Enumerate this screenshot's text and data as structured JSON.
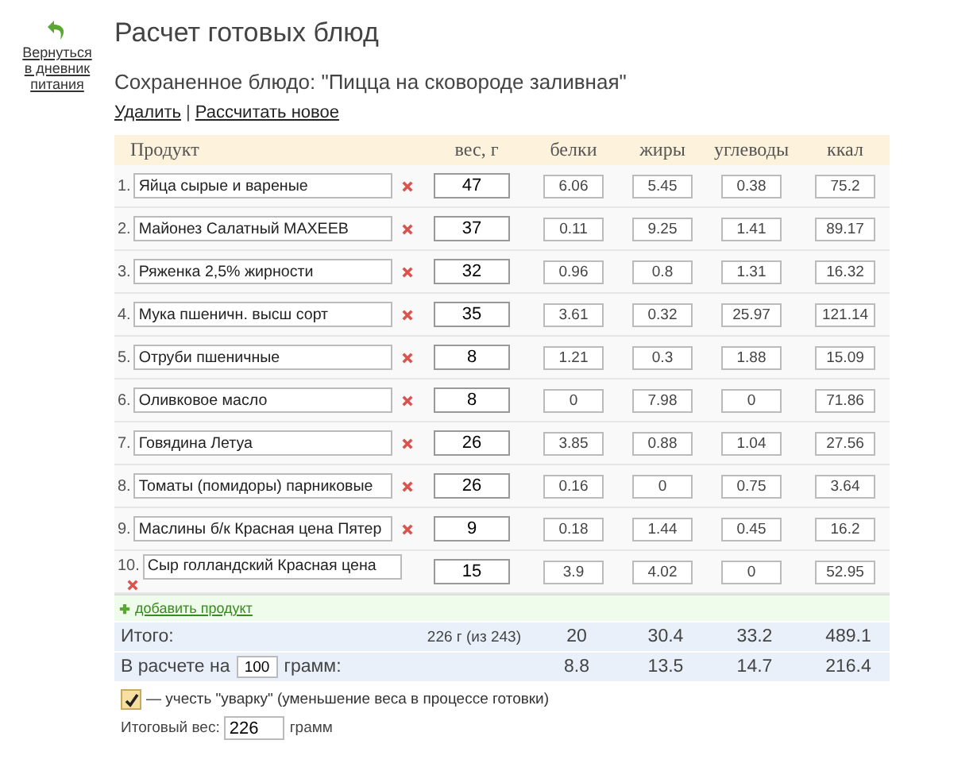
{
  "back_link": {
    "label": "Вернуться в дневник питания"
  },
  "title": "Расчет готовых блюд",
  "saved_dish": "Сохраненное блюдо: \"Пицца на сковороде заливная\"",
  "actions": [
    "Удалить",
    "Рассчитать новое"
  ],
  "action_separator": "|",
  "table": {
    "columns": [
      "Продукт",
      "вес, г",
      "белки",
      "жиры",
      "углеводы",
      "ккал"
    ],
    "rows": [
      {
        "number": "1.",
        "product": "Яйца сырые и вареные",
        "weight": "47",
        "values": [
          "6.06",
          "5.45",
          "0.38",
          "75.2"
        ]
      },
      {
        "number": "2.",
        "product": "Майонез Салатный МАХЕЕВ",
        "weight": "37",
        "values": [
          "0.11",
          "9.25",
          "1.41",
          "89.17"
        ]
      },
      {
        "number": "3.",
        "product": "Ряженка 2,5% жирности",
        "weight": "32",
        "values": [
          "0.96",
          "0.8",
          "1.31",
          "16.32"
        ]
      },
      {
        "number": "4.",
        "product": "Мука пшеничн. высш сорт",
        "weight": "35",
        "values": [
          "3.61",
          "0.32",
          "25.97",
          "121.14"
        ]
      },
      {
        "number": "5.",
        "product": "Отруби пшеничные",
        "weight": "8",
        "values": [
          "1.21",
          "0.3",
          "1.88",
          "15.09"
        ]
      },
      {
        "number": "6.",
        "product": "Оливковое масло",
        "weight": "8",
        "values": [
          "0",
          "7.98",
          "0",
          "71.86"
        ]
      },
      {
        "number": "7.",
        "product": "Говядина Летуа",
        "weight": "26",
        "values": [
          "3.85",
          "0.88",
          "1.04",
          "27.56"
        ]
      },
      {
        "number": "8.",
        "product": "Томаты (помидоры) парниковые",
        "weight": "26",
        "values": [
          "0.16",
          "0",
          "0.75",
          "3.64"
        ]
      },
      {
        "number": "9.",
        "product": "Маслины б/к Красная цена Пятер",
        "weight": "9",
        "values": [
          "0.18",
          "1.44",
          "0.45",
          "16.2"
        ]
      },
      {
        "number": "10.",
        "product": "Сыр голландский Красная цена",
        "weight": "15",
        "values": [
          "3.9",
          "4.02",
          "0",
          "52.95"
        ]
      }
    ]
  },
  "add_product": "добавить продукт",
  "totals": {
    "label": "Итого:",
    "weight": "226 г (из 243)",
    "values": [
      "20",
      "30.4",
      "33.2",
      "489.1"
    ]
  },
  "per_portion": {
    "label_before": "В расчете на",
    "amount": "100",
    "label_after": "грамм:",
    "values": [
      "8.8",
      "13.5",
      "14.7",
      "216.4"
    ]
  },
  "boil_down": {
    "checked": true,
    "label": "— учесть \"уварку\" (уменьшение веса в процессе готовки)"
  },
  "final_weight": {
    "label": "Итоговый вес:",
    "value": "226",
    "unit": "грамм"
  }
}
